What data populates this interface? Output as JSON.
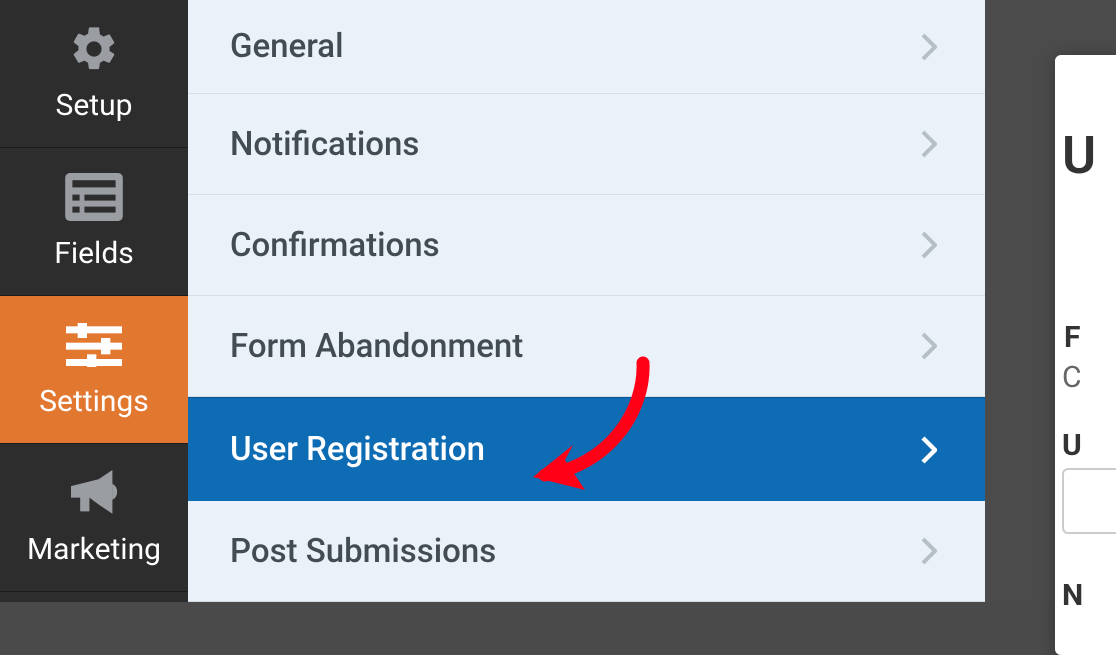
{
  "sidebar": {
    "items": [
      {
        "label": "Setup",
        "icon": "gear"
      },
      {
        "label": "Fields",
        "icon": "list"
      },
      {
        "label": "Settings",
        "icon": "sliders"
      },
      {
        "label": "Marketing",
        "icon": "megaphone"
      }
    ],
    "activeIndex": 2
  },
  "panel": {
    "items": [
      {
        "label": "General"
      },
      {
        "label": "Notifications"
      },
      {
        "label": "Confirmations"
      },
      {
        "label": "Form Abandonment"
      },
      {
        "label": "User Registration"
      },
      {
        "label": "Post Submissions"
      }
    ],
    "selectedIndex": 4
  },
  "peek": {
    "heading": "U",
    "line2a": "F",
    "line2b": "C",
    "line3": "U",
    "line4": "N"
  },
  "colors": {
    "sidebar_bg": "#2d2d2d",
    "active_bg": "#e27730",
    "panel_bg": "#eaf1f8",
    "selected_bg": "#0e6cb5",
    "text": "#444c53",
    "arrow": "#ff0016"
  }
}
